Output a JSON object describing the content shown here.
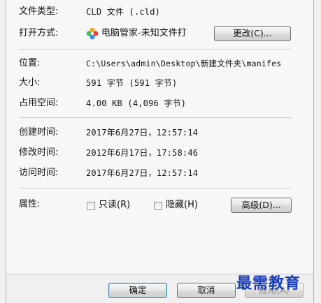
{
  "general": {
    "file_type_label": "文件类型:",
    "file_type_value": "CLD 文件 (.cld)",
    "opens_with_label": "打开方式:",
    "opens_with_app": "电脑管家-未知文件打",
    "change_button": "更改(C)...",
    "location_label": "位置:",
    "location_value": "C:\\Users\\admin\\Desktop\\新建文件夹\\manifes",
    "size_label": "大小:",
    "size_value": "591 字节 (591 字节)",
    "size_on_disk_label": "占用空间:",
    "size_on_disk_value": "4.00 KB (4,096 字节)",
    "created_label": "创建时间:",
    "created_value": "2017年6月27日，12:57:14",
    "modified_label": "修改时间:",
    "modified_value": "2012年6月17日，17:58:46",
    "accessed_label": "访问时间:",
    "accessed_value": "2017年6月27日，12:57:14",
    "attributes_label": "属性:",
    "readonly_label": "只读(R)",
    "readonly_checked": false,
    "hidden_label": "隐藏(H)",
    "hidden_checked": false,
    "advanced_button": "高级(D)..."
  },
  "footer": {
    "ok_button": "确定",
    "cancel_button": "取消",
    "apply_button": "应用(A)"
  },
  "watermark": "最需教育",
  "colors": {
    "watermark": "#1a3fb8",
    "dialog_bg": "#f0f0f0",
    "page_bg": "#f7f7f7"
  }
}
